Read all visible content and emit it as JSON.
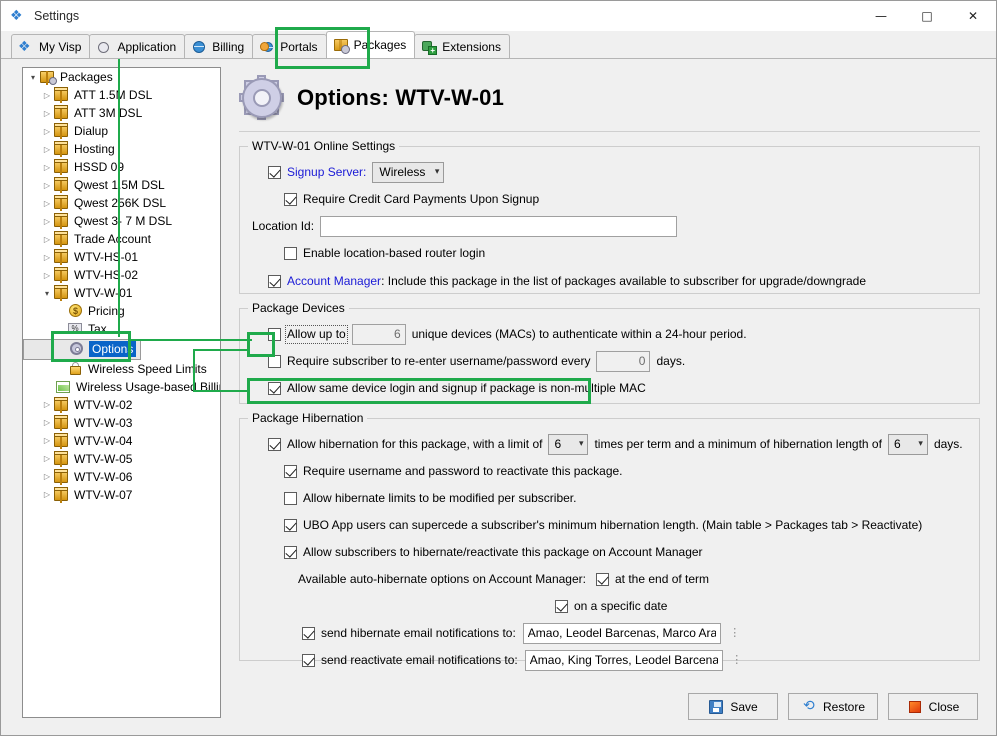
{
  "window": {
    "title": "Settings",
    "icon": "app-foot-icon",
    "minimize": "—",
    "maximize": "□",
    "close": "✕"
  },
  "tabs": [
    {
      "label": "My Visp",
      "icon": "foot-icon",
      "active": false
    },
    {
      "label": "Application",
      "icon": "clock-icon",
      "active": false
    },
    {
      "label": "Billing",
      "icon": "globe-icon",
      "active": false
    },
    {
      "label": "Portals",
      "icon": "people-globe-icon",
      "active": false
    },
    {
      "label": "Packages",
      "icon": "package-gear-icon",
      "active": true
    },
    {
      "label": "Extensions",
      "icon": "puzzle-plus-icon",
      "active": false
    }
  ],
  "tree": [
    {
      "label": "Packages",
      "icon": "packages-root-icon",
      "depth": 0,
      "arrow": "open",
      "selected": false
    },
    {
      "label": "ATT 1.5M DSL",
      "icon": "package-icon",
      "depth": 1,
      "arrow": "collapsed",
      "selected": false
    },
    {
      "label": "ATT 3M DSL",
      "icon": "package-icon",
      "depth": 1,
      "arrow": "collapsed",
      "selected": false
    },
    {
      "label": "Dialup",
      "icon": "package-icon",
      "depth": 1,
      "arrow": "collapsed",
      "selected": false
    },
    {
      "label": "Hosting",
      "icon": "package-icon",
      "depth": 1,
      "arrow": "collapsed",
      "selected": false
    },
    {
      "label": "HSSD 09",
      "icon": "package-icon",
      "depth": 1,
      "arrow": "collapsed",
      "selected": false
    },
    {
      "label": "Qwest 1.5M DSL",
      "icon": "package-icon",
      "depth": 1,
      "arrow": "collapsed",
      "selected": false
    },
    {
      "label": "Qwest 256K DSL",
      "icon": "package-icon",
      "depth": 1,
      "arrow": "collapsed",
      "selected": false
    },
    {
      "label": "Qwest 3- 7 M DSL",
      "icon": "package-icon",
      "depth": 1,
      "arrow": "collapsed",
      "selected": false
    },
    {
      "label": "Trade Account",
      "icon": "package-icon",
      "depth": 1,
      "arrow": "collapsed",
      "selected": false
    },
    {
      "label": "WTV-HS-01",
      "icon": "package-icon",
      "depth": 1,
      "arrow": "collapsed",
      "selected": false
    },
    {
      "label": "WTV-HS-02",
      "icon": "package-icon",
      "depth": 1,
      "arrow": "collapsed",
      "selected": false
    },
    {
      "label": "WTV-W-01",
      "icon": "package-icon",
      "depth": 1,
      "arrow": "open",
      "selected": false
    },
    {
      "label": "Pricing",
      "icon": "coin-icon",
      "depth": 2,
      "arrow": "none",
      "selected": false
    },
    {
      "label": "Tax",
      "icon": "percent-icon",
      "depth": 2,
      "arrow": "none",
      "selected": false
    },
    {
      "label": "Options",
      "icon": "gear-icon",
      "depth": 2,
      "arrow": "none",
      "selected": true
    },
    {
      "label": "Wireless Speed Limits",
      "icon": "lock-icon",
      "depth": 2,
      "arrow": "none",
      "selected": false
    },
    {
      "label": "Wireless Usage-based Billing",
      "icon": "chart-icon",
      "depth": 2,
      "arrow": "none",
      "selected": false
    },
    {
      "label": "WTV-W-02",
      "icon": "package-icon",
      "depth": 1,
      "arrow": "collapsed",
      "selected": false
    },
    {
      "label": "WTV-W-03",
      "icon": "package-icon",
      "depth": 1,
      "arrow": "collapsed",
      "selected": false
    },
    {
      "label": "WTV-W-04",
      "icon": "package-icon",
      "depth": 1,
      "arrow": "collapsed",
      "selected": false
    },
    {
      "label": "WTV-W-05",
      "icon": "package-icon",
      "depth": 1,
      "arrow": "collapsed",
      "selected": false
    },
    {
      "label": "WTV-W-06",
      "icon": "package-icon",
      "depth": 1,
      "arrow": "collapsed",
      "selected": false
    },
    {
      "label": "WTV-W-07",
      "icon": "package-icon",
      "depth": 1,
      "arrow": "collapsed",
      "selected": false
    }
  ],
  "page": {
    "title": "Options: WTV-W-01",
    "icon": "big-gear-icon"
  },
  "online_settings": {
    "legend": "WTV-W-01 Online Settings",
    "signup_server": {
      "label": "Signup Server:",
      "checked": true,
      "value": "Wireless"
    },
    "require_cc": {
      "label": "Require Credit Card Payments Upon Signup",
      "checked": true
    },
    "location_id": {
      "label": "Location Id:",
      "value": "",
      "placeholder": ""
    },
    "enable_router_login": {
      "label": "Enable location-based router login",
      "checked": false
    },
    "account_manager": {
      "link": "Account Manager",
      "label": ": Include this package in the list of packages available to subscriber for upgrade/downgrade",
      "checked": true
    }
  },
  "package_devices": {
    "legend": "Package Devices",
    "allow_up_to": {
      "checked": false,
      "label_before": "Allow up to",
      "value": "6",
      "label_after": "unique devices (MACs) to authenticate within a 24-hour period."
    },
    "reenter": {
      "checked": false,
      "label_before": "Require subscriber to re-enter username/password every",
      "value": "0",
      "label_after": "days."
    },
    "same_device": {
      "checked": true,
      "label": "Allow same device login and signup if package is non-multiple MAC"
    }
  },
  "package_hibernation": {
    "legend": "Package Hibernation",
    "allow_hibernation": {
      "checked": true,
      "label_a": "Allow hibernation for this package, with a limit of",
      "limit": "6",
      "label_b": "times per term and a minimum of hibernation length of",
      "length": "6",
      "label_c": "days."
    },
    "require_user_pass": {
      "checked": true,
      "label": "Require username and password to reactivate this package."
    },
    "modify_limits": {
      "checked": false,
      "label": "Allow hibernate limits to be modified per subscriber."
    },
    "ubo_supercede": {
      "checked": true,
      "label": "UBO App users can supercede a subscriber's minimum hibernation length. (Main table > Packages tab > Reactivate)"
    },
    "allow_subscribers": {
      "checked": true,
      "label": "Allow subscribers to hibernate/reactivate this package on Account Manager"
    },
    "auto_hibernate_label": "Available auto-hibernate options on Account Manager:",
    "end_of_term": {
      "checked": true,
      "label": "at the end of term"
    },
    "specific_date": {
      "checked": true,
      "label": "on a specific date"
    },
    "hibernate_email": {
      "checked": true,
      "label": "send hibernate email notifications to:",
      "value": "Amao, Leodel Barcenas, Marco Aranet..."
    },
    "reactivate_email": {
      "checked": true,
      "label": "send reactivate email notifications to:",
      "value": "Amao, King Torres, Leodel Barcenas,..."
    }
  },
  "buttons": {
    "save": {
      "label": "Save",
      "icon": "floppy-icon"
    },
    "restore": {
      "label": "Restore",
      "icon": "refresh-icon"
    },
    "close": {
      "label": "Close",
      "icon": "stop-icon"
    }
  },
  "annotation": {
    "color": "#1faa4b",
    "targets": [
      "packages-tab",
      "options-tree-item",
      "allow-up-to-checkbox",
      "same-device-checkbox"
    ]
  }
}
